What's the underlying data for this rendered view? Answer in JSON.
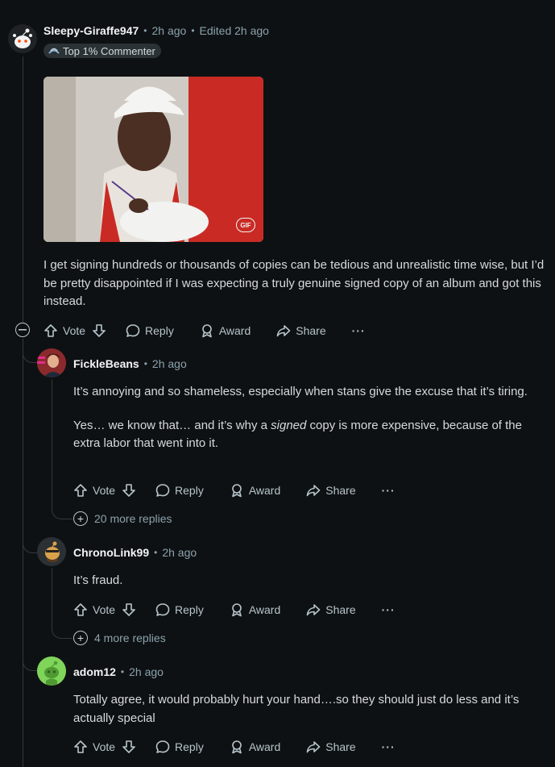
{
  "comments": [
    {
      "username": "Sleepy-Giraffe947",
      "time": "2h ago",
      "edited": "Edited 2h ago",
      "badge": "Top 1% Commenter",
      "gif_label": "GIF",
      "body": "I get signing hundreds or thousands of copies can be tedious and unrealistic time wise, but I’d be pretty disappointed if I was expecting a truly genuine signed copy of an album and got this instead."
    },
    {
      "username": "FickleBeans",
      "time": "2h ago",
      "body_p1": "It’s annoying and so shameless, especially when stans give the excuse that it’s tiring.",
      "body_p2_a": "Yes… we know that… and it’s why a ",
      "body_p2_em": "signed",
      "body_p2_b": " copy is more expensive, because of the extra labor that went into it.",
      "more_replies": "20 more replies"
    },
    {
      "username": "ChronoLink99",
      "time": "2h ago",
      "body": "It’s fraud.",
      "more_replies": "4 more replies"
    },
    {
      "username": "adom12",
      "time": "2h ago",
      "body": "Totally agree, it would probably hurt your hand….so they should just do less and it’s actually special"
    }
  ],
  "actions": {
    "vote": "Vote",
    "reply": "Reply",
    "award": "Award",
    "share": "Share",
    "more": "···"
  },
  "colors": {
    "background": "#0e1113",
    "text": "#d7dadc",
    "meta": "#8ba2ad",
    "thread_line": "#33383c",
    "adom_avatar": "#7fd45a"
  }
}
